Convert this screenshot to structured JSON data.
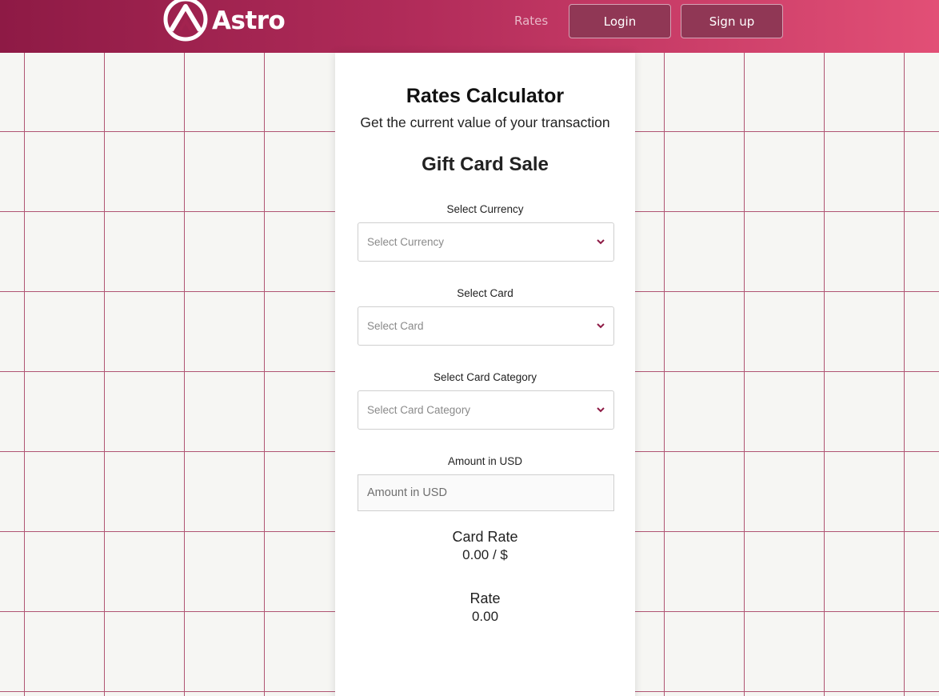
{
  "header": {
    "logo_text": "Astro",
    "nav": {
      "rates": "Rates"
    },
    "buttons": {
      "login": "Login",
      "signup": "Sign up"
    }
  },
  "calculator": {
    "title": "Rates Calculator",
    "subtitle": "Get the current value of your transaction",
    "section_title": "Gift Card Sale",
    "currency": {
      "label": "Select Currency",
      "placeholder": "Select Currency"
    },
    "card": {
      "label": "Select Card",
      "placeholder": "Select Card"
    },
    "category": {
      "label": "Select Card Category",
      "placeholder": "Select Card Category"
    },
    "amount": {
      "label": "Amount in USD",
      "placeholder": "Amount in USD",
      "value": ""
    },
    "card_rate": {
      "label": "Card Rate",
      "value": "0.00 / $"
    },
    "rate": {
      "label": "Rate",
      "value": "0.00"
    }
  },
  "colors": {
    "header_gradient": [
      "#8e1a45",
      "#e24f76"
    ],
    "accent": "#8e1a45",
    "grid_line": "#b05573",
    "background": "#f6f6f3"
  },
  "icons": {
    "logo": "triangle-circle-logo-icon",
    "select_arrow": "chevron-down-icon"
  }
}
